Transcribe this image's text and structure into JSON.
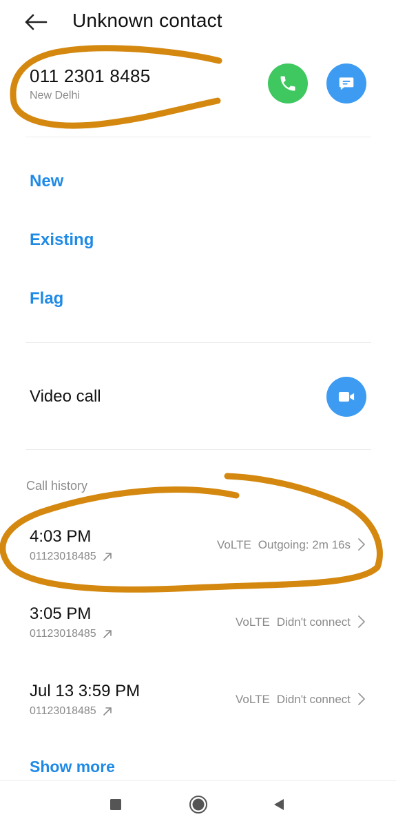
{
  "header": {
    "title": "Unknown contact"
  },
  "contact": {
    "number": "011 2301 8485",
    "location": "New Delhi"
  },
  "actions": [
    {
      "label": "New"
    },
    {
      "label": "Existing"
    },
    {
      "label": "Flag"
    }
  ],
  "video_call": {
    "label": "Video call"
  },
  "call_history": {
    "label": "Call history",
    "items": [
      {
        "time": "4:03 PM",
        "number": "01123018485",
        "network": "VoLTE",
        "status": "Outgoing: 2m 16s"
      },
      {
        "time": "3:05 PM",
        "number": "01123018485",
        "network": "VoLTE",
        "status": "Didn't connect"
      },
      {
        "time": "Jul 13 3:59 PM",
        "number": "01123018485",
        "network": "VoLTE",
        "status": "Didn't connect"
      }
    ],
    "show_more": "Show more"
  },
  "icons": {
    "back": "arrow-left-icon",
    "call": "phone-icon",
    "message": "message-icon",
    "video": "video-camera-icon",
    "outgoing": "arrow-up-right-icon",
    "chevron": "chevron-right-icon",
    "nav_recents": "square-icon",
    "nav_home": "circle-icon",
    "nav_back": "triangle-left-icon"
  },
  "colors": {
    "accent_blue": "#1f8ae6",
    "call_green": "#3ec85f",
    "button_blue": "#3d9bf2",
    "annotation": "#d4880f"
  }
}
